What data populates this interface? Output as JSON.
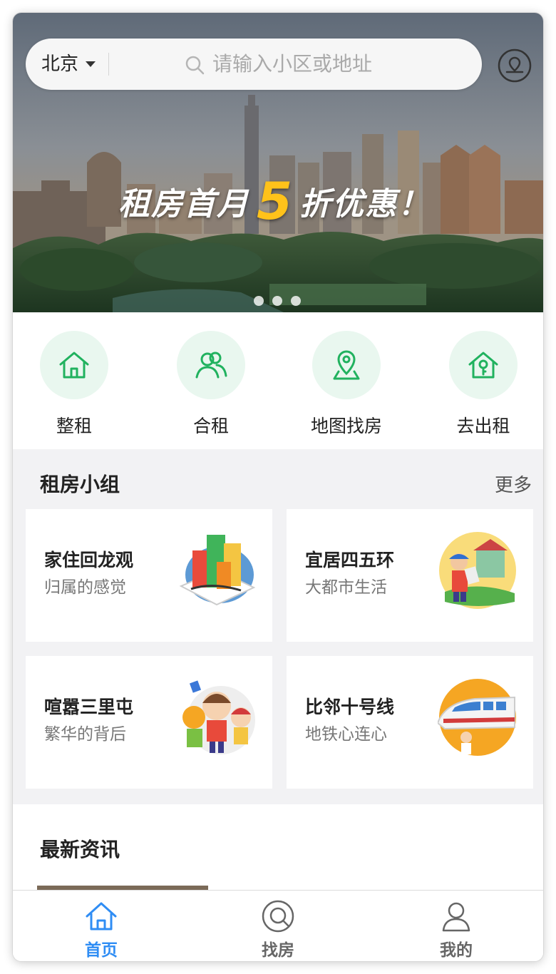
{
  "search": {
    "city": "北京",
    "placeholder": "请输入小区或地址"
  },
  "banner": {
    "promo_prefix": "租房首月",
    "promo_number": "5",
    "promo_suffix": "折优惠！",
    "slide_count": 3,
    "active_slide": 1
  },
  "quick_actions": [
    {
      "label": "整租",
      "icon": "house-icon"
    },
    {
      "label": "合租",
      "icon": "people-icon"
    },
    {
      "label": "地图找房",
      "icon": "map-pin-icon"
    },
    {
      "label": "去出租",
      "icon": "house-key-icon"
    }
  ],
  "groups": {
    "title": "租房小组",
    "more": "更多",
    "items": [
      {
        "title": "家住回龙观",
        "subtitle": "归属的感觉",
        "icon": "city-buildings-icon"
      },
      {
        "title": "宜居四五环",
        "subtitle": "大都市生活",
        "icon": "person-house-icon"
      },
      {
        "title": "喧嚣三里屯",
        "subtitle": "繁华的背后",
        "icon": "happy-people-icon"
      },
      {
        "title": "比邻十号线",
        "subtitle": "地铁心连心",
        "icon": "train-icon"
      }
    ]
  },
  "news": {
    "title": "最新资讯"
  },
  "tabbar": {
    "items": [
      {
        "label": "首页",
        "icon": "home-icon",
        "active": true
      },
      {
        "label": "找房",
        "icon": "search-house-icon",
        "active": false
      },
      {
        "label": "我的",
        "icon": "user-icon",
        "active": false
      }
    ]
  },
  "colors": {
    "accent": "#21b25f",
    "tab_active": "#2f8df4",
    "tab_inactive": "#666666",
    "promo_number": "#ffc21a"
  }
}
